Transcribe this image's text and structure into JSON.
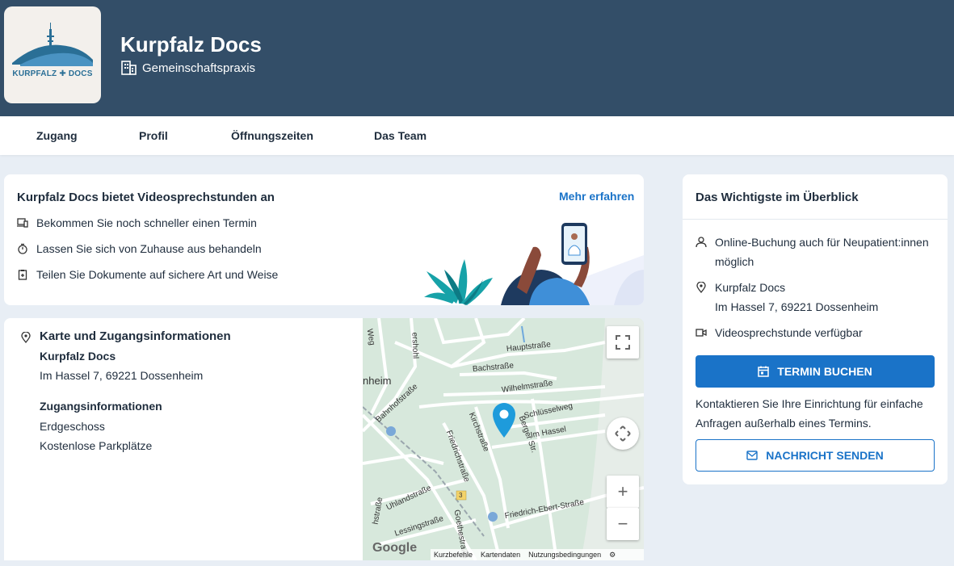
{
  "header": {
    "logo_text": "KURPFALZ ✚ DOCS",
    "name": "Kurpfalz Docs",
    "type": "Gemeinschaftspraxis"
  },
  "nav": [
    "Zugang",
    "Profil",
    "Öffnungszeiten",
    "Das Team"
  ],
  "video": {
    "title": "Kurpfalz Docs bietet Videosprechstunden an",
    "more_link": "Mehr erfahren",
    "benefits": [
      {
        "icon": "devices-icon",
        "text": "Bekommen Sie noch schneller einen Termin"
      },
      {
        "icon": "stopwatch-icon",
        "text": "Lassen Sie sich von Zuhause aus behandeln"
      },
      {
        "icon": "clipboard-icon",
        "text": "Teilen Sie Dokumente auf sichere Art und Weise"
      }
    ]
  },
  "access": {
    "title": "Karte und Zugangsinformationen",
    "practice": "Kurpfalz Docs",
    "address": "Im Hassel 7, 69221 Dossenheim",
    "info_title": "Zugangsinformationen",
    "info": [
      "Erdgeschoss",
      "Kostenlose Parkplätze"
    ]
  },
  "map": {
    "streets": [
      "Hauptstraße",
      "Bachstraße",
      "Wilhelmstraße",
      "Schlüsselweg",
      "Im Hassel",
      "Bahnhofstraße",
      "Friedrichstraße",
      "Kirchstraße",
      "Uhlandstraße",
      "Goethestraße",
      "Lessingstraße",
      "Friedrich-Ebert-Straße",
      "Weg",
      "ershohl",
      "nheim",
      "hstraße",
      "Berger Str."
    ],
    "route_number": "3",
    "footer": [
      "Kurzbefehle",
      "Kartendaten",
      "Nutzungsbedingungen"
    ],
    "google": "Google"
  },
  "overview": {
    "title": "Das Wichtigste im Überblick",
    "booking": "Online-Buchung auch für Neupatient:innen möglich",
    "location_name": "Kurpfalz Docs",
    "location_address": "Im Hassel 7, 69221 Dossenheim",
    "video": "Videosprechstunde verfügbar",
    "book_button": "TERMIN BUCHEN",
    "contact_text": "Kontaktieren Sie Ihre Einrichtung für einfache Anfragen außerhalb eines Termins.",
    "message_button": "NACHRICHT SENDEN"
  },
  "colors": {
    "header": "#334e68",
    "accent": "#1a73c8"
  }
}
